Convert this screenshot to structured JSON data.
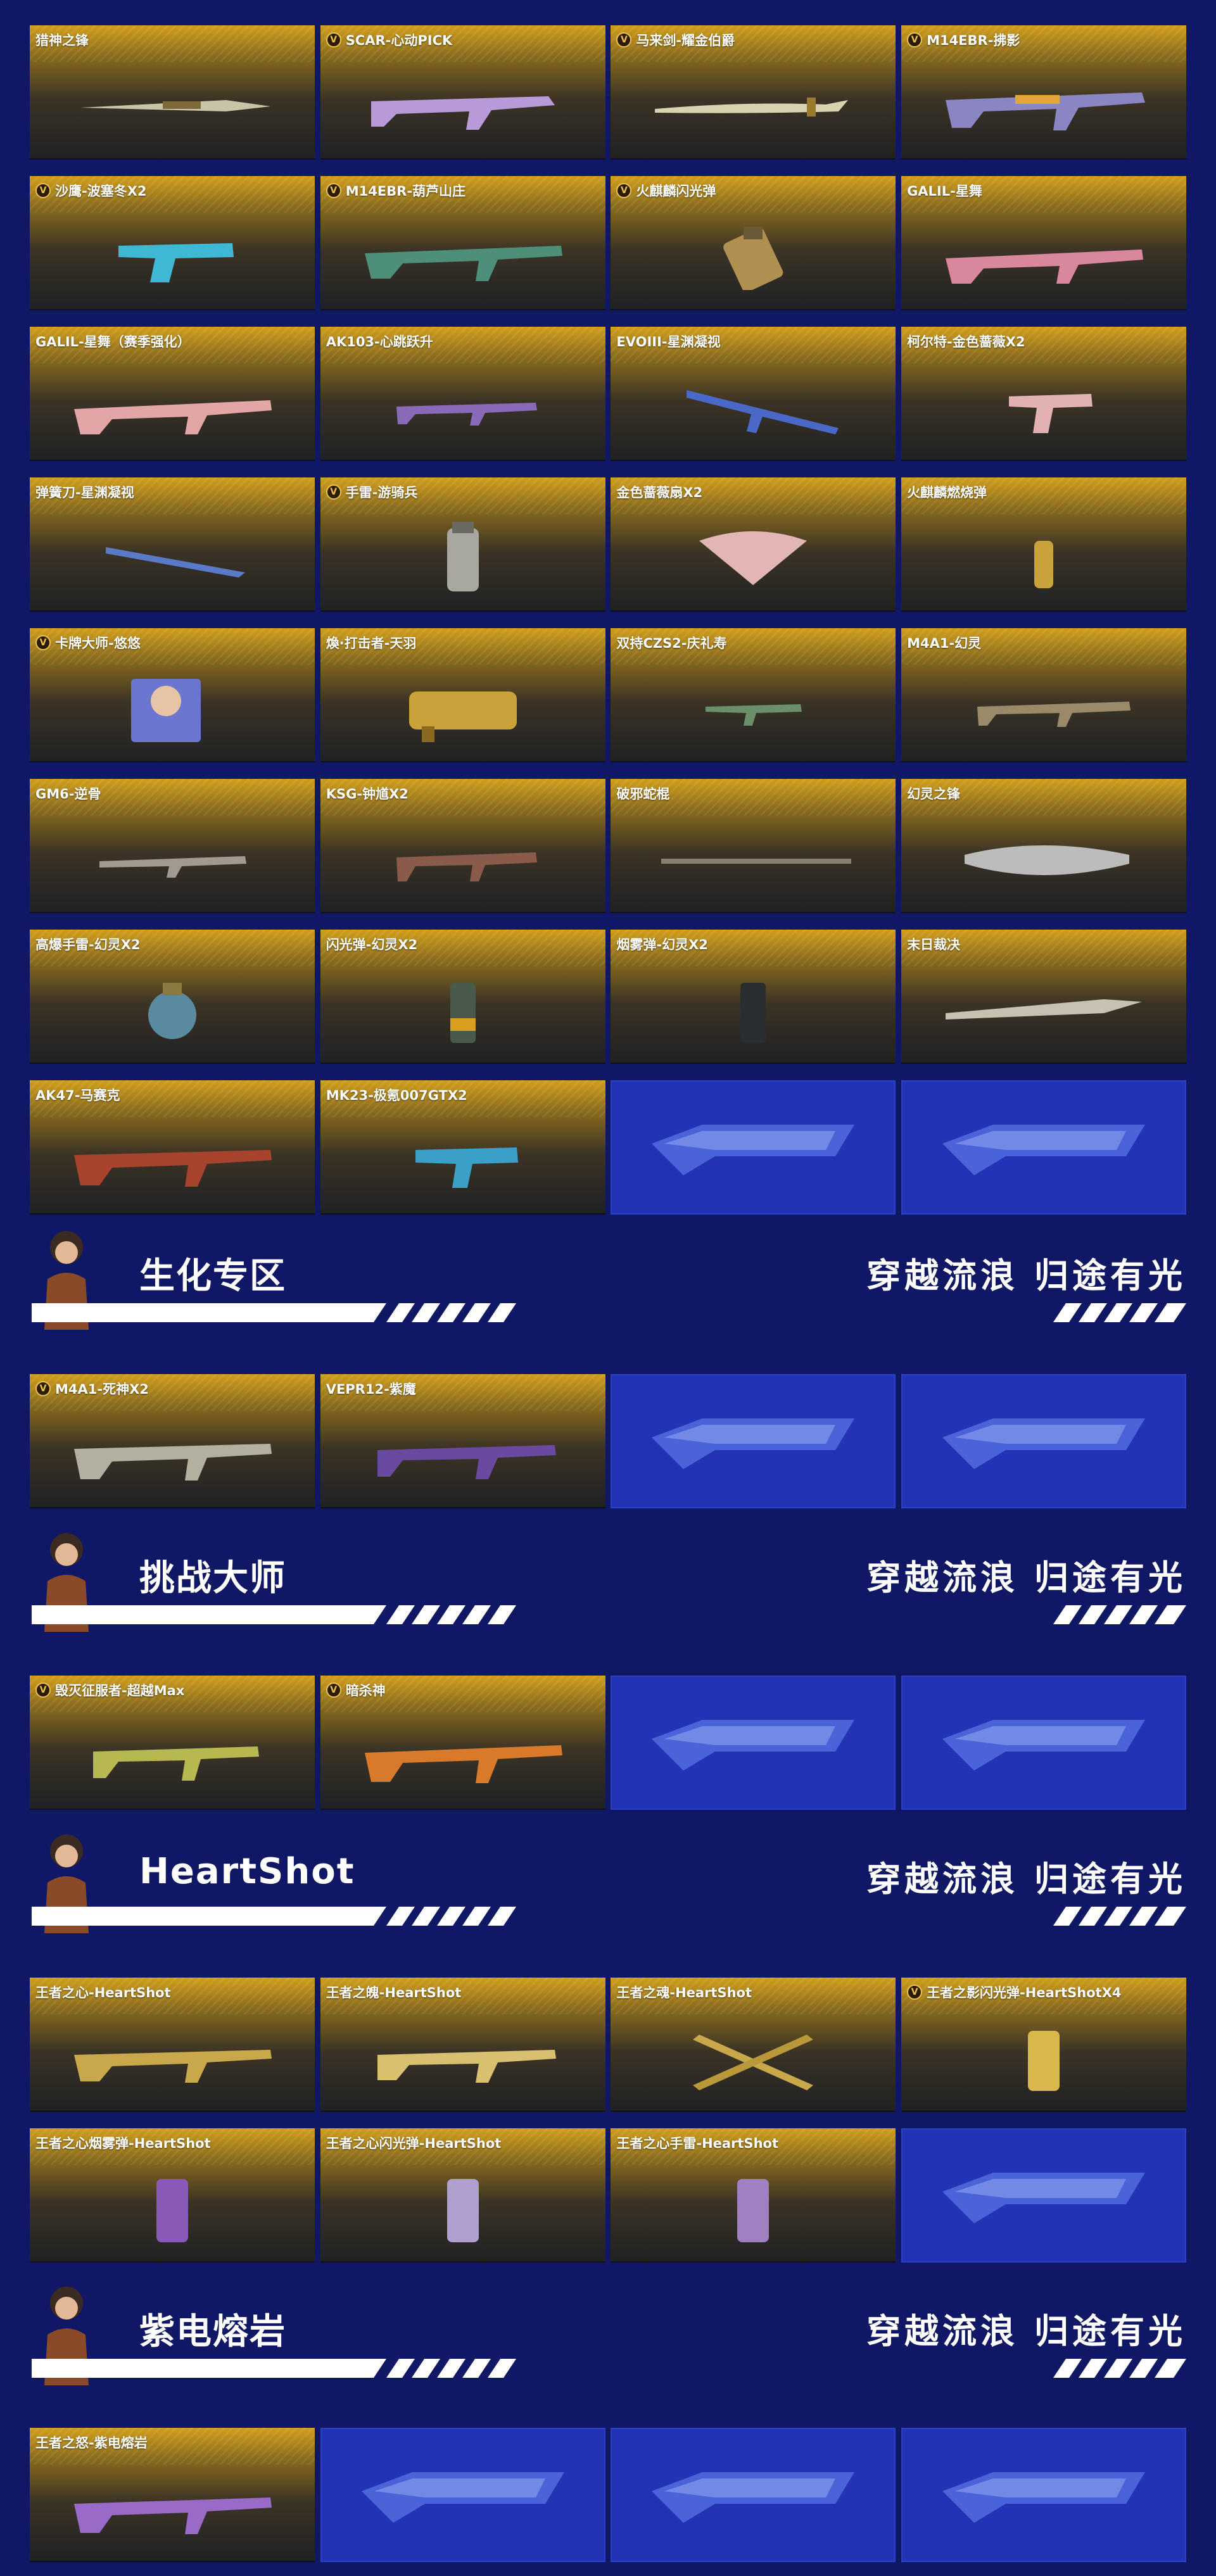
{
  "slogan": "穿越流浪 归途有光",
  "colors": {
    "background": "#101866",
    "card_top": "#d29f1b",
    "card_bottom": "#202124",
    "logo_card": "#2233b6",
    "text": "#ffffff"
  },
  "logo_icon": "crossfire-logo-icon",
  "groups": [
    {
      "items": [
        {
          "label": "猎神之锋",
          "v": false
        },
        {
          "label": "SCAR-心动PICK",
          "v": true
        },
        {
          "label": "马来剑-耀金伯爵",
          "v": true
        },
        {
          "label": "M14EBR-拂影",
          "v": true
        },
        {
          "label": "沙鹰-波塞冬X2",
          "v": true
        },
        {
          "label": "M14EBR-葫芦山庄",
          "v": true
        },
        {
          "label": "火麒麟闪光弹",
          "v": true
        },
        {
          "label": "GALIL-星舞",
          "v": false
        },
        {
          "label": "GALIL-星舞（赛季强化）",
          "v": false
        },
        {
          "label": "AK103-心跳跃升",
          "v": false
        },
        {
          "label": "EVOIII-星渊凝视",
          "v": false
        },
        {
          "label": "柯尔特-金色蔷薇X2",
          "v": false
        },
        {
          "label": "弹簧刀-星渊凝视",
          "v": false
        },
        {
          "label": "手雷-游骑兵",
          "v": true
        },
        {
          "label": "金色蔷薇扇X2",
          "v": false
        },
        {
          "label": "火麒麟燃烧弹",
          "v": false
        },
        {
          "label": "卡牌大师-悠悠",
          "v": true
        },
        {
          "label": "煥·打击者-天羽",
          "v": false
        },
        {
          "label": "双持CZS2-庆礼寿",
          "v": false
        },
        {
          "label": "M4A1-幻灵",
          "v": false
        },
        {
          "label": "GM6-逆骨",
          "v": false
        },
        {
          "label": "KSG-钟馗X2",
          "v": false
        },
        {
          "label": "破邪蛇棍",
          "v": false
        },
        {
          "label": "幻灵之锋",
          "v": false
        },
        {
          "label": "高爆手雷-幻灵X2",
          "v": false
        },
        {
          "label": "闪光弹-幻灵X2",
          "v": false
        },
        {
          "label": "烟雾弹-幻灵X2",
          "v": false
        },
        {
          "label": "末日裁决",
          "v": false
        },
        {
          "label": "AK47-马赛克",
          "v": false
        },
        {
          "label": "MK23-极氪007GTX2",
          "v": false
        }
      ]
    },
    {
      "title": "生化专区",
      "items": [
        {
          "label": "M4A1-死神X2",
          "v": true
        },
        {
          "label": "VEPR12-紫魔",
          "v": false
        }
      ]
    },
    {
      "title": "挑战大师",
      "items": [
        {
          "label": "毁灭征服者-超越Max",
          "v": true
        },
        {
          "label": "暗杀神",
          "v": true
        }
      ]
    },
    {
      "title": "HeartShot",
      "items": [
        {
          "label": "王者之心-HeartShot",
          "v": false
        },
        {
          "label": "王者之魄-HeartShot",
          "v": false
        },
        {
          "label": "王者之魂-HeartShot",
          "v": false
        },
        {
          "label": "王者之影闪光弹-HeartShotX4",
          "v": true
        },
        {
          "label": "王者之心烟雾弹-HeartShot",
          "v": false
        },
        {
          "label": "王者之心闪光弹-HeartShot",
          "v": false
        },
        {
          "label": "王者之心手雷-HeartShot",
          "v": false
        }
      ]
    },
    {
      "title": "紫电熔岩",
      "items": [
        {
          "label": "王者之怒-紫电熔岩",
          "v": false
        }
      ]
    }
  ]
}
